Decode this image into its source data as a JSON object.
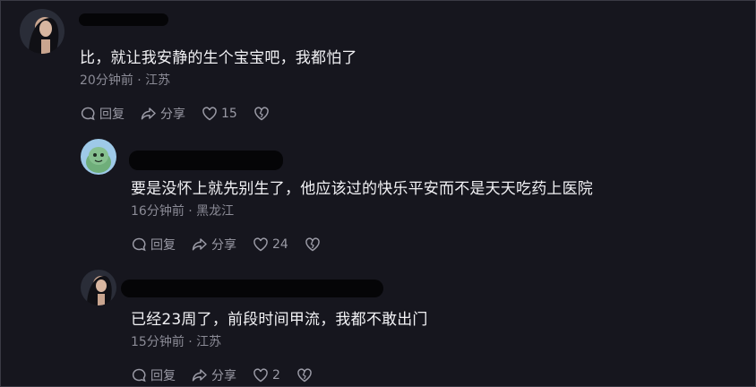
{
  "comments": [
    {
      "text": "比，就让我安静的生个宝宝吧，我都怕了",
      "meta": "20分钟前 · 江苏",
      "reply_label": "回复",
      "share_label": "分享",
      "likes": "15"
    },
    {
      "text": "要是没怀上就先别生了，他应该过的快乐平安而不是天天吃药上医院",
      "meta": "16分钟前 · 黑龙江",
      "reply_label": "回复",
      "share_label": "分享",
      "likes": "24"
    },
    {
      "text": "已经23周了，前段时间甲流，我都不敢出门",
      "meta": "15分钟前 · 江苏",
      "reply_label": "回复",
      "share_label": "分享",
      "likes": "2"
    }
  ],
  "icons": {
    "reply": "reply-bubble-icon",
    "share": "share-arrow-icon",
    "like": "heart-icon",
    "dislike": "broken-heart-icon"
  },
  "colors": {
    "background": "#16161e",
    "text": "#f2f2f5",
    "muted": "#8b8b96"
  }
}
